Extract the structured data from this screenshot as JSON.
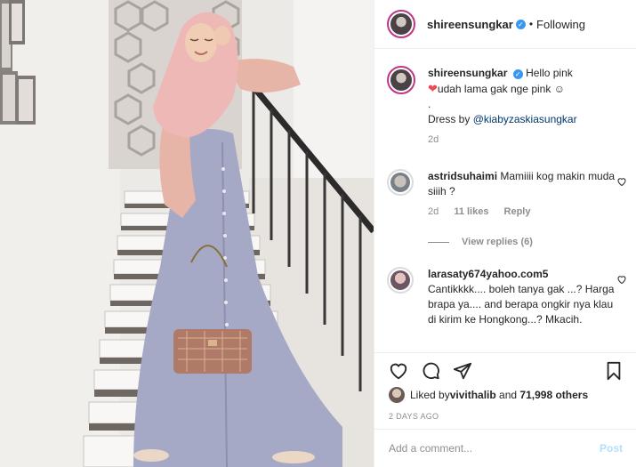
{
  "header": {
    "username": "shireensungkar",
    "verified_icon": "verified-badge-icon",
    "separator": "•",
    "follow_status": "Following"
  },
  "caption": {
    "username": "shireensungkar",
    "line1": "Hello pink",
    "line2": "udah lama gak nge pink",
    "emoji": "☺",
    "dot": ".",
    "dress_prefix": "Dress by ",
    "dress_mention": "@kiabyzaskiasungkar",
    "time": "2d"
  },
  "comments": [
    {
      "username": "astridsuhaimi",
      "text": "Mamiiii kog makin muda siiih ?",
      "time": "2d",
      "likes": "11 likes",
      "reply": "Reply",
      "view_replies": "View replies (6)"
    },
    {
      "username": "larasaty674yahoo.com5",
      "text": "Cantikkkk.... boleh tanya gak ...? Harga brapa ya.... and berapa ongkir nya klau di kirim ke Hongkong...? Mkacih."
    }
  ],
  "likes": {
    "prefix": "Liked by ",
    "user": "vivithalib",
    "middle": " and ",
    "others": "71,998 others"
  },
  "time_ago": "2 DAYS AGO",
  "add_comment": {
    "placeholder": "Add a comment...",
    "post_label": "Post"
  },
  "colors": {
    "verified": "#3897f0",
    "heart": "#ed4956",
    "link": "#00376b",
    "post_disabled": "#b2dffc",
    "story_ring": "#c13584"
  }
}
